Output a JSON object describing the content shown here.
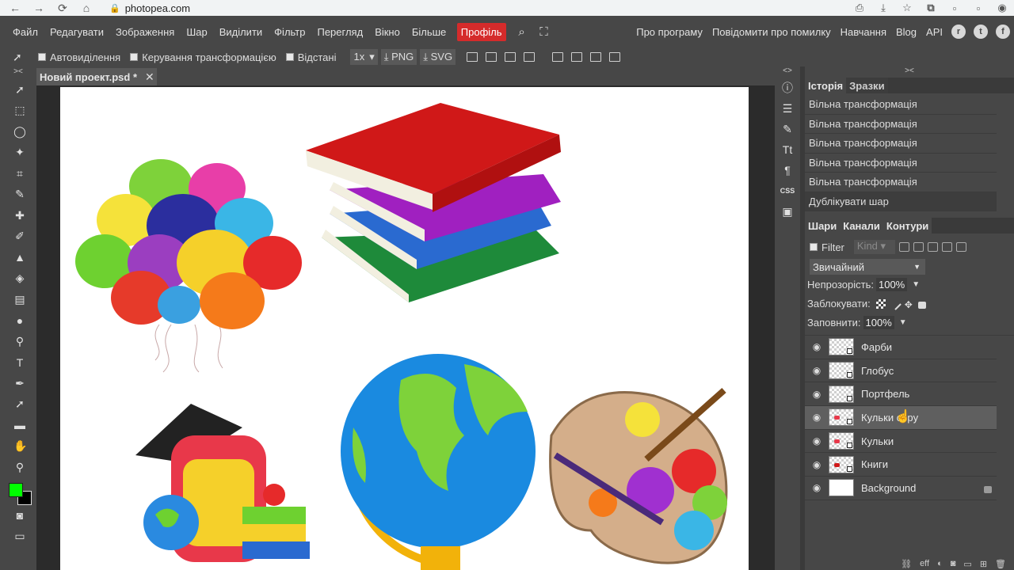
{
  "browser": {
    "url": "photopea.com",
    "nav_icons": [
      "back-icon",
      "forward-icon",
      "reload-icon",
      "home-icon"
    ],
    "right_icons": [
      "share-icon",
      "download-icon",
      "star-icon",
      "pdf-icon",
      "extension-icon",
      "extension-icon",
      "profile-icon"
    ]
  },
  "menu": {
    "items": [
      "Файл",
      "Редагувати",
      "Зображення",
      "Шар",
      "Виділити",
      "Фільтр",
      "Перегляд",
      "Вікно",
      "Більше"
    ],
    "profile": "Профіль",
    "right_items": [
      "Про програму",
      "Повідомити про помилку",
      "Навчання",
      "Blog",
      "API"
    ],
    "social_icons": [
      "reddit-icon",
      "twitter-icon",
      "facebook-icon"
    ]
  },
  "options": {
    "auto_select": "Автовиділення",
    "transform_controls": "Керування трансформацією",
    "distances": "Відстані",
    "zoom": "1x",
    "png": "PNG",
    "svg": "SVG"
  },
  "document": {
    "tab_title": "Новий проект.psd *"
  },
  "history": {
    "tabs": [
      "Історія",
      "Зразки"
    ],
    "items": [
      "Вільна трансформація",
      "Вільна трансформація",
      "Вільна трансформація",
      "Вільна трансформація",
      "Вільна трансформація",
      "Дублікувати шар"
    ]
  },
  "layers_panel": {
    "tabs": [
      "Шари",
      "Канали",
      "Контури"
    ],
    "filter_label": "Filter",
    "kind_label": "Kind",
    "blend_mode": "Звичайний",
    "opacity_label": "Непрозорість:",
    "opacity_value": "100%",
    "lock_label": "Заблокувати:",
    "fill_label": "Заповнити:",
    "fill_value": "100%",
    "layers": [
      "Фарби",
      "Глобус",
      "Портфель",
      "Кульки copy",
      "Кульки",
      "Книги",
      "Background"
    ],
    "selected_layer": "Кульки copy"
  },
  "colors": {
    "foreground": "#00ff00",
    "background": "#000000",
    "accent": "#d52b2b"
  }
}
